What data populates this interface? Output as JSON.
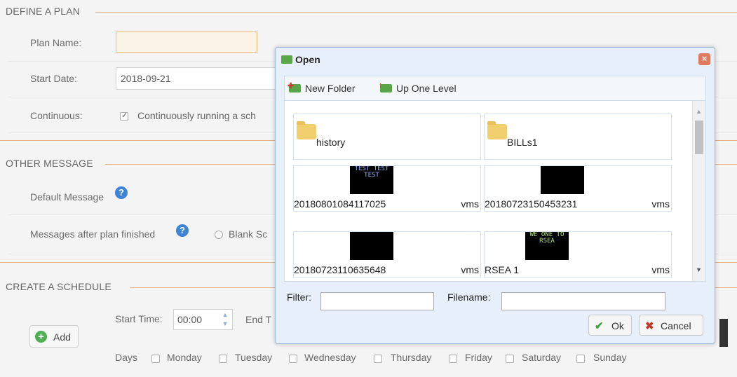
{
  "sections": {
    "define": "DEFINE A PLAN",
    "other": "OTHER MESSAGE",
    "schedule": "CREATE A SCHEDULE"
  },
  "plan": {
    "name_label": "Plan Name:",
    "name_value": "",
    "start_date_label": "Start Date:",
    "start_date_value": "2018-09-21",
    "continuous_label": "Continuous:",
    "continuous_text": "Continuously running a sch"
  },
  "other": {
    "default_message_label": "Default Message",
    "after_finished_label": "Messages after plan finished",
    "blank_option": "Blank Sc"
  },
  "schedule": {
    "add_label": "Add",
    "start_time_label": "Start Time:",
    "start_time_value": "00:00",
    "end_time_label": "End T",
    "days_label": "Days",
    "days": [
      "Monday",
      "Tuesday",
      "Wednesday",
      "Thursday",
      "Friday",
      "Saturday",
      "Sunday"
    ]
  },
  "dialog": {
    "title": "Open",
    "close_glyph": "×",
    "toolbar": {
      "new_folder": "New Folder",
      "up_one_level": "Up One Level"
    },
    "files": [
      {
        "name": "history",
        "ext": "",
        "kind": "folder"
      },
      {
        "name": "BILLs1",
        "ext": "",
        "kind": "folder"
      },
      {
        "name": "20180801084117025",
        "ext": "vms",
        "kind": "vms",
        "thumb": "TEST TEST TEST"
      },
      {
        "name": "20180723150453231",
        "ext": "vms",
        "kind": "vms",
        "thumb": ""
      },
      {
        "name": "20180723110635648",
        "ext": "vms",
        "kind": "vms",
        "thumb": ""
      },
      {
        "name": "RSEA 1",
        "ext": "vms",
        "kind": "vms",
        "thumb": "WE ONE TO RSEA"
      }
    ],
    "filter_label": "Filter:",
    "filter_value": "",
    "filename_label": "Filename:",
    "filename_value": "",
    "ok_label": "Ok",
    "cancel_label": "Cancel"
  }
}
